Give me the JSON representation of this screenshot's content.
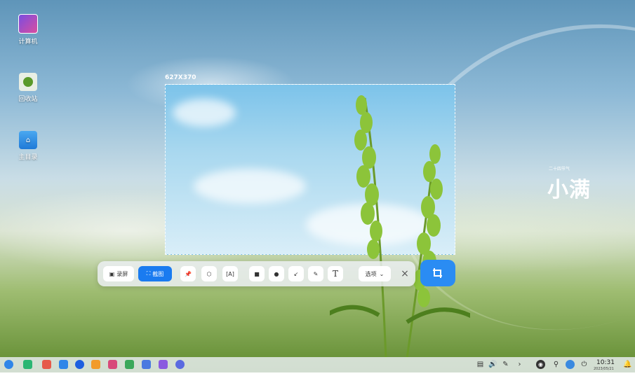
{
  "desktop": {
    "icons": [
      {
        "label": "计算机",
        "icon": "computer-icon"
      },
      {
        "label": "回收站",
        "icon": "trash-icon"
      },
      {
        "label": "主目录",
        "icon": "home-folder-icon"
      }
    ]
  },
  "screenshot": {
    "dimensions": "627X370"
  },
  "toolbar": {
    "record_label": "录屏",
    "capture_label": "截图",
    "options_label": "选项",
    "tools": [
      "pin-icon",
      "blur-icon",
      "ocr-icon",
      "rectangle-icon",
      "ellipse-icon",
      "arrow-icon",
      "pen-icon",
      "text-icon"
    ],
    "close_glyph": "×",
    "text_tool_glyph": "T"
  },
  "wallpaper": {
    "festival_caption": "二十四节气",
    "festival_name": "小满"
  },
  "taskbar": {
    "time": "10:31",
    "date": "2023/05/21"
  },
  "colors": {
    "accent": "#1a7bf0",
    "confirm": "#2a8cf3"
  }
}
